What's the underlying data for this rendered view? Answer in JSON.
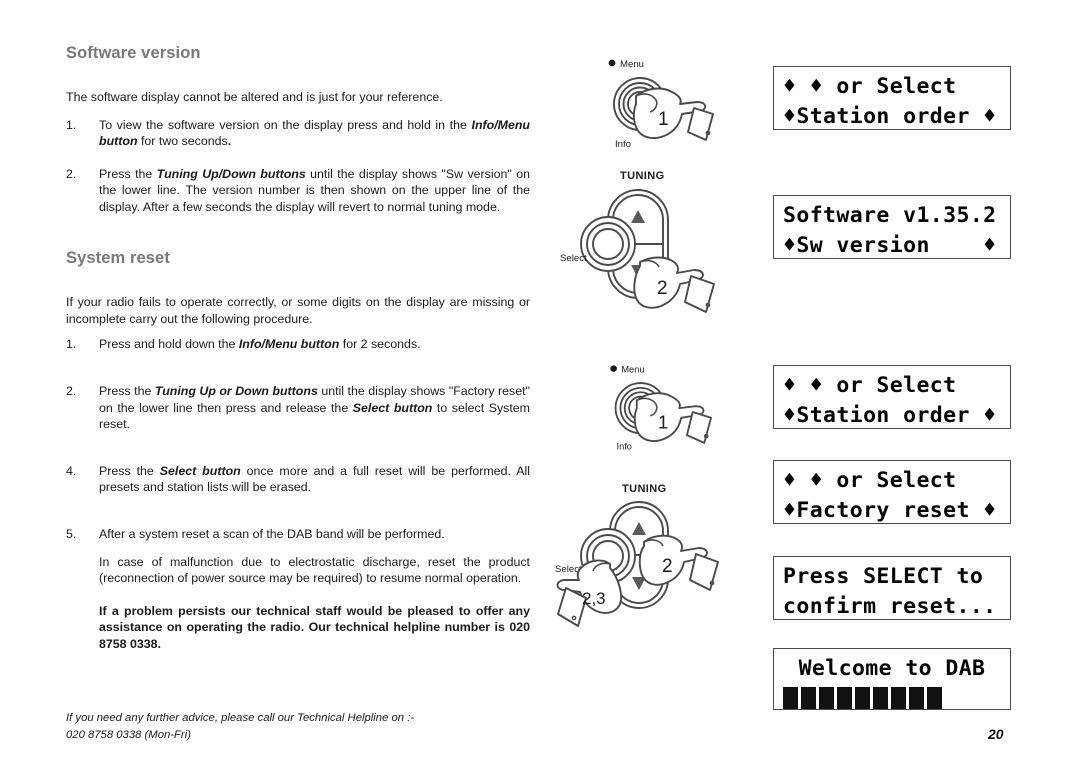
{
  "page_number": "20",
  "sections": [
    {
      "heading": "Software version",
      "lead": "The software display cannot be altered and is just for your reference.",
      "steps": [
        {
          "num": "1.",
          "parts": [
            {
              "t": "To view the software version on the display press and hold in the ",
              "style": "normal"
            },
            {
              "t": "Info/Menu button",
              "style": "bold-italic"
            },
            {
              "t": " for two seconds",
              "style": "normal"
            },
            {
              "t": ".",
              "style": "bold"
            }
          ]
        },
        {
          "num": "2.",
          "parts": [
            {
              "t": "Press the ",
              "style": "normal"
            },
            {
              "t": "Tuning Up/Down buttons",
              "style": "bold-italic"
            },
            {
              "t": " until the display shows \"Sw version\" on the lower line. The version number is then shown on the upper line of the display. After a few seconds the display will revert to normal tuning mode.",
              "style": "normal"
            }
          ]
        }
      ]
    },
    {
      "heading": "System reset",
      "lead": "If your radio fails to operate correctly, or some digits on the display are missing or incomplete carry out the following procedure.",
      "steps": [
        {
          "num": "1.",
          "parts": [
            {
              "t": "Press and hold down the ",
              "style": "normal"
            },
            {
              "t": "Info/Menu button",
              "style": "bold-italic"
            },
            {
              "t": " for 2 seconds.",
              "style": "normal"
            }
          ]
        },
        {
          "num": "2.",
          "parts": [
            {
              "t": "Press the ",
              "style": "normal"
            },
            {
              "t": "Tuning Up or Down buttons",
              "style": "bold-italic"
            },
            {
              "t": " until the display shows \"Factory reset\" on the lower line then press and release the ",
              "style": "normal"
            },
            {
              "t": "Select button",
              "style": "bold-italic"
            },
            {
              "t": " to select System reset.",
              "style": "normal"
            }
          ]
        },
        {
          "num": "4.",
          "parts": [
            {
              "t": "Press the ",
              "style": "normal"
            },
            {
              "t": "Select button",
              "style": "bold-italic"
            },
            {
              "t": " once more and a full reset will be performed. All presets and station lists will be erased.",
              "style": "normal"
            }
          ]
        },
        {
          "num": "5.",
          "parts": [
            {
              "t": "After a system reset a scan of the DAB band will be performed.",
              "style": "normal"
            }
          ],
          "sub": "In case of malfunction due to electrostatic discharge, reset the product (reconnection of power source may be required) to resume normal operation."
        }
      ],
      "helpline": "If a problem persists our technical staff would be pleased to offer any assistance on operating the radio. Our technical helpline number is 020 8758 0338."
    }
  ],
  "footer": {
    "line1": "If you need any further advice, please call our Technical Helpline on :-",
    "line2": "020 8758 0338 (Mon-Fri)"
  },
  "illustrations": [
    {
      "id": "info-menu-1",
      "type": "info-menu-button",
      "label_top": "Menu",
      "label_bottom": "Info",
      "hand_number": "1"
    },
    {
      "id": "tuning-1",
      "type": "tuning-rocker",
      "label_top": "TUNING",
      "label_select": "Select",
      "hand_number": "2"
    },
    {
      "id": "info-menu-2",
      "type": "info-menu-button",
      "label_top": "Menu",
      "label_bottom": "Info",
      "hand_number": "1"
    },
    {
      "id": "tuning-2",
      "type": "tuning-rocker-two-hands",
      "label_top": "TUNING",
      "label_select": "Select",
      "hand_number": "2",
      "hand_number_select": "2,3"
    }
  ],
  "displays": [
    {
      "id": "display-station-order-1",
      "line1": "♦ ♦ or Select",
      "line2": "♦Station order ♦"
    },
    {
      "id": "display-software-version",
      "line1": "Software v1.35.2",
      "line2": "♦Sw version    ♦"
    },
    {
      "id": "display-station-order-2",
      "line1": "♦ ♦ or Select",
      "line2": "♦Station order ♦"
    },
    {
      "id": "display-factory-reset",
      "line1": "♦ ♦ or Select",
      "line2": "♦Factory reset ♦"
    },
    {
      "id": "display-confirm-reset",
      "line1": "Press SELECT to",
      "line2": "confirm reset..."
    },
    {
      "id": "display-welcome",
      "line1": "Welcome to DAB",
      "progress_blocks": 9
    }
  ]
}
